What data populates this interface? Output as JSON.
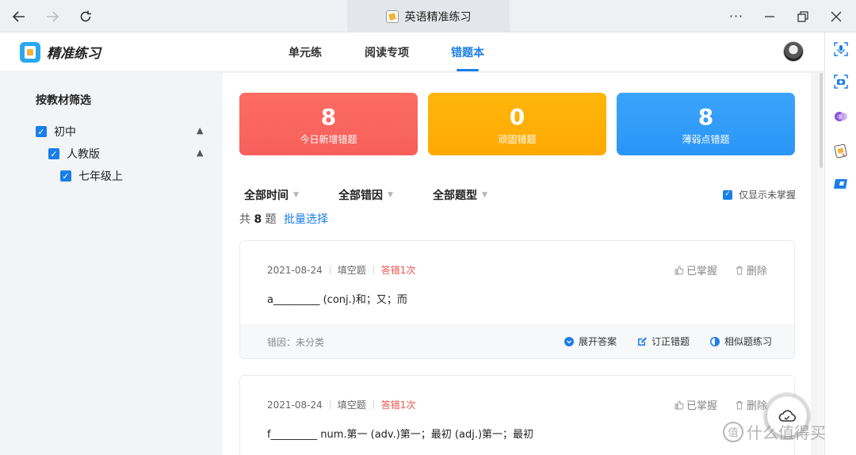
{
  "window": {
    "title": "英语精准练习"
  },
  "app": {
    "brand": "精准练习",
    "tabs": [
      {
        "label": "单元练",
        "active": false
      },
      {
        "label": "阅读专项",
        "active": false
      },
      {
        "label": "错题本",
        "active": true
      }
    ]
  },
  "filter_panel": {
    "title": "按教材筛选",
    "tree": [
      {
        "label": "初中",
        "checked": true,
        "expanded": true
      },
      {
        "label": "人教版",
        "checked": true,
        "expanded": true
      },
      {
        "label": "七年级上",
        "checked": true
      }
    ]
  },
  "stats": [
    {
      "value": "8",
      "label": "今日新增错题",
      "color": "#fc6360"
    },
    {
      "value": "0",
      "label": "顽固错题",
      "color": "#ffaf06"
    },
    {
      "value": "8",
      "label": "薄弱点错题",
      "color": "#2f9bfa"
    }
  ],
  "filters": {
    "time": "全部时间",
    "reason": "全部错因",
    "type": "全部题型",
    "only_unmastered": "仅显示未掌握"
  },
  "summary": {
    "prefix": "共",
    "count": "8",
    "suffix": "题",
    "batch": "批量选择"
  },
  "cards": [
    {
      "date": "2021-08-24",
      "type": "填空题",
      "wrong": "答错1次",
      "mastered": "已掌握",
      "delete": "删除",
      "question": "a_________ (conj.)和；又；而",
      "reason": "错因：未分类",
      "actions": [
        "展开答案",
        "订正错题",
        "相似题练习"
      ]
    },
    {
      "date": "2021-08-24",
      "type": "填空题",
      "wrong": "答错1次",
      "mastered": "已掌握",
      "delete": "删除",
      "question": "f_________ num.第一 (adv.)第一；最初 (adj.)第一；最初"
    }
  ],
  "watermark": {
    "symbol": "值",
    "text": "什么值得买"
  },
  "colors": {
    "accent": "#1a7ee8",
    "error": "#f0514a"
  }
}
